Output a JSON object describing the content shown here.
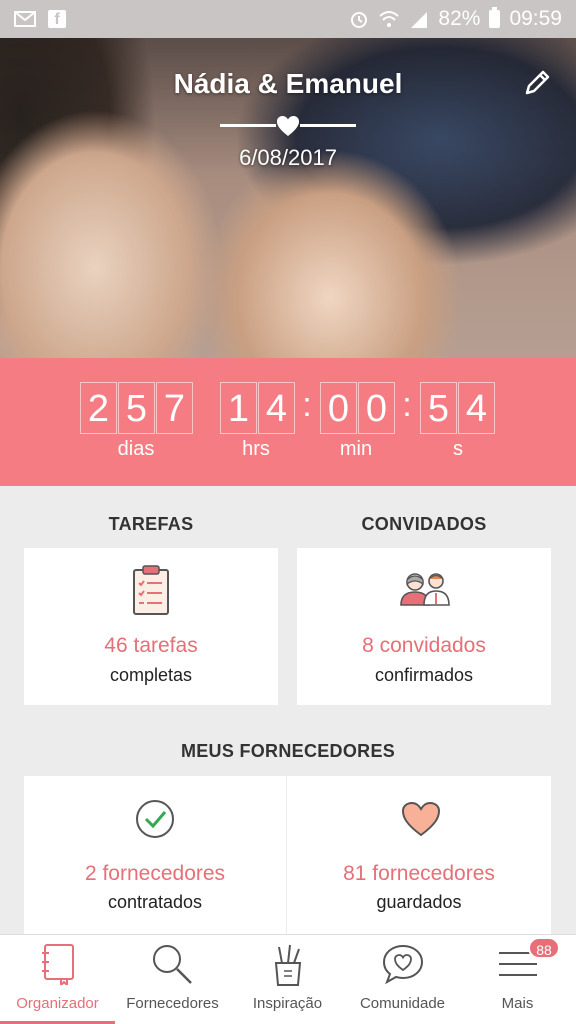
{
  "status_bar": {
    "battery_percent": "82%",
    "time": "09:59",
    "icons": [
      "mail-icon",
      "facebook-icon",
      "alarm-icon",
      "wifi-icon",
      "signal-icon",
      "battery-icon"
    ]
  },
  "hero": {
    "couple_name": "Nádia & Emanuel",
    "wedding_date": "6/08/2017"
  },
  "countdown": {
    "days": [
      "2",
      "5",
      "7"
    ],
    "hours": [
      "1",
      "4"
    ],
    "minutes": [
      "0",
      "0"
    ],
    "seconds": [
      "5",
      "4"
    ],
    "labels": {
      "days": "dias",
      "hours": "hrs",
      "minutes": "min",
      "seconds": "s"
    }
  },
  "tasks": {
    "title": "TAREFAS",
    "main": "46 tarefas",
    "sub": "completas",
    "icon": "checklist-icon"
  },
  "guests": {
    "title": "CONVIDADOS",
    "main": "8 convidados",
    "sub": "confirmados",
    "icon": "guests-icon"
  },
  "vendors": {
    "title": "MEUS FORNECEDORES",
    "hired": {
      "main": "2 fornecedores",
      "sub": "contratados",
      "icon": "check-circle-icon"
    },
    "saved": {
      "main": "81 fornecedores",
      "sub": "guardados",
      "icon": "heart-icon"
    }
  },
  "bottom_nav": {
    "items": [
      {
        "label": "Organizador",
        "icon": "notebook-icon",
        "active": true
      },
      {
        "label": "Fornecedores",
        "icon": "search-icon",
        "active": false
      },
      {
        "label": "Inspiração",
        "icon": "pencil-cup-icon",
        "active": false
      },
      {
        "label": "Comunidade",
        "icon": "chat-heart-icon",
        "active": false
      },
      {
        "label": "Mais",
        "icon": "menu-icon",
        "active": false,
        "badge": "88"
      }
    ]
  },
  "colors": {
    "accent": "#e66f78",
    "countdown_bg": "#f57c83",
    "background": "#ececec",
    "status_bar": "#c9c5c4"
  }
}
